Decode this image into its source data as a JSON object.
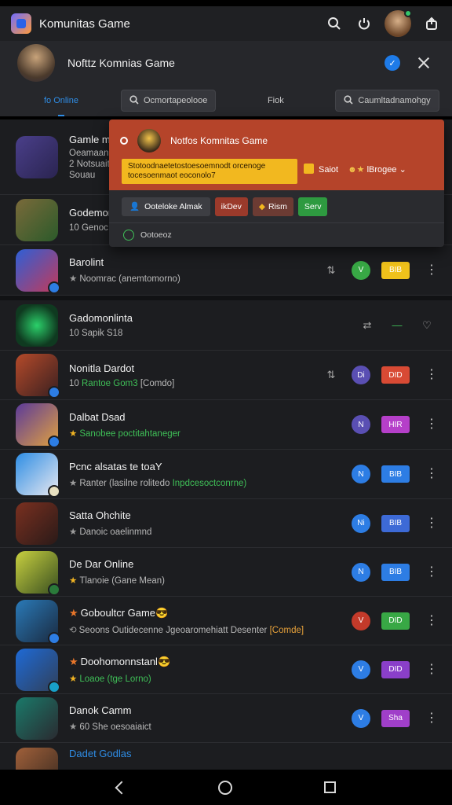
{
  "app": {
    "title": "Komunitas Game",
    "icons": [
      "search-icon",
      "power-icon",
      "avatar",
      "share-icon"
    ],
    "online_dot_color": "#35c66b"
  },
  "notification_header": {
    "title": "Nofttz Komnias Game",
    "check_label": "✓"
  },
  "tabs": [
    {
      "label": "fo Online",
      "active": true
    },
    {
      "label": "Ocmortapeolooe",
      "icon": "search-icon"
    },
    {
      "label": "Fiok"
    },
    {
      "label": "Caumltadnamohgy",
      "icon": "search-icon"
    }
  ],
  "popup": {
    "title": "Notfos Komnitas Game",
    "banner": "Stotoodnaetetostoesoemnodt orcenoge tocesoenmaot eoconolo7",
    "save_label": "Saiot",
    "badge_label": "lBrogee",
    "chips": [
      "Ooteloke Almak",
      "ikDev",
      "Rism",
      "Serv"
    ],
    "footer": "Ootoeoz",
    "colors": {
      "header": "#b5442a",
      "banner": "#f2b81f"
    }
  },
  "rows": [
    {
      "name": "Gamle mu",
      "sub_lines": [
        "Oeamaanesonad",
        "2 Notsuaitaitea",
        "Souau"
      ],
      "thumb": [
        "#4a3f8a",
        "#2a2450"
      ]
    },
    {
      "name": "Godemomra",
      "sub": "10 Genoc",
      "thumb": [
        "#7a6a3a",
        "#2b5a2a"
      ]
    },
    {
      "name": "Barolint",
      "sub": "Noomrac (anemtomorno)",
      "star_icon": "gray",
      "circle": {
        "label": "V",
        "color": "#38a845"
      },
      "pill": {
        "label": "BIB",
        "color": "#f0c21b"
      },
      "thumb": [
        "#2e5fd6",
        "#c23a5a"
      ]
    },
    {
      "name": "Gadomonlinta",
      "sub": "10 Sapik S18",
      "dash": "—",
      "thumb": [
        "#1e7a3a",
        "#0f3a20"
      ]
    },
    {
      "name": "Nonitla Dardot",
      "sub_green": "Rantoe Gom3",
      "sub_prefix": "10",
      "sub_suffix": "[Comdo]",
      "circle": {
        "label": "Di",
        "color": "#5a4fb3"
      },
      "pill": {
        "label": "DID",
        "color": "#d84a34"
      },
      "thumb": [
        "#b54a2a",
        "#3a2020"
      ]
    },
    {
      "name": "Dalbat Dsad",
      "sub_green": "Sanobee poctitahtaneger",
      "star_icon": "gold",
      "circle": {
        "label": "N",
        "color": "#5a4fb3"
      },
      "pill": {
        "label": "HIR",
        "color": "#b53fc9"
      },
      "thumb": [
        "#5b3a9a",
        "#e0a040"
      ]
    },
    {
      "name": "Pcnc alsatas te toaY",
      "sub": "Ranter (lasilne rolitedo",
      "sub_green": "Inpdcesoctconrne)",
      "star_icon": "gray",
      "circle": {
        "label": "N",
        "color": "#2d7de4"
      },
      "pill": {
        "label": "BIB",
        "color": "#2d7de4"
      },
      "thumb": [
        "#2d8de4",
        "#e8e8f0"
      ]
    },
    {
      "name": "Satta Ohchite",
      "sub": "Danoic oaelinmnd",
      "star_icon": "gray",
      "circle": {
        "label": "Ni",
        "color": "#2d7de4"
      },
      "pill": {
        "label": "BIB",
        "color": "#3d6ad6"
      },
      "thumb": [
        "#7a3020",
        "#2a1a18"
      ]
    },
    {
      "name": "De Dar Online",
      "sub": "Tlanoie (Gane Mean)",
      "star_icon": "gold",
      "circle": {
        "label": "N",
        "color": "#2d7de4"
      },
      "pill": {
        "label": "BIB",
        "color": "#2d7de4"
      },
      "thumb": [
        "#c8d040",
        "#3a5020"
      ]
    },
    {
      "name": "Goboultcr Game😎",
      "sub": "Seoons Outidecenne Jgeoaromehiatt Desenter",
      "sub_orange": "[Comde]",
      "star_icon": "orange",
      "circle": {
        "label": "V",
        "color": "#c43a2a"
      },
      "pill": {
        "label": "DID",
        "color": "#38a845"
      },
      "thumb": [
        "#2a7ab8",
        "#1a2a40"
      ]
    },
    {
      "name": "Doohomonnstanl😎",
      "sub_green": "Loaoe (tge Lorno)",
      "star_icon": "gold",
      "circle": {
        "label": "V",
        "color": "#2d7de4"
      },
      "pill": {
        "label": "DID",
        "color": "#8a3fc9"
      },
      "thumb": [
        "#1e6ad6",
        "#30405a"
      ]
    },
    {
      "name": "Danok Camm",
      "sub": "60 She oesoaiaict",
      "star_icon": "gray",
      "circle": {
        "label": "V",
        "color": "#2d7de4"
      },
      "pill": {
        "label": "Sha",
        "color": "#a03fc9"
      },
      "thumb": [
        "#1a7a6a",
        "#2a2a30"
      ]
    },
    {
      "name": "Dadet Godlas",
      "sub": "",
      "thumb": [
        "#a0603a",
        "#3a2a20"
      ]
    }
  ],
  "nav": [
    "back-icon",
    "home-icon",
    "recents-icon"
  ]
}
